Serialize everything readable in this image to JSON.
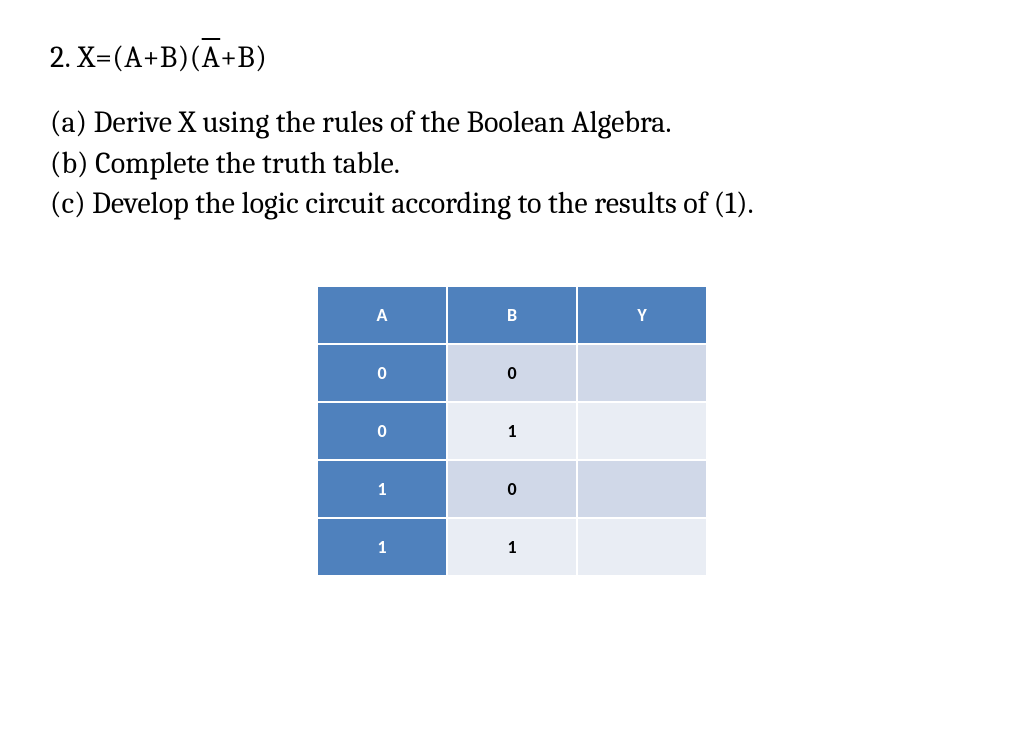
{
  "problem": {
    "number": "2.",
    "eq_lhs": "X=",
    "eq_paren1_open": "(",
    "eq_A1": "A",
    "eq_plus1": "+",
    "eq_B1": "B",
    "eq_paren1_close": ")",
    "eq_paren2_open": "(",
    "eq_Abar": "A",
    "eq_plus2": "+",
    "eq_B2": "B",
    "eq_paren2_close": ")"
  },
  "parts": {
    "a": "(a) Derive X using the rules of the Boolean Algebra.",
    "b": "(b) Complete the truth table.",
    "c": "(c) Develop the logic circuit according to the results of (1)."
  },
  "table": {
    "headers": {
      "A": "A",
      "B": "B",
      "Y": "Y"
    },
    "rows": [
      {
        "A": "0",
        "B": "0",
        "Y": ""
      },
      {
        "A": "0",
        "B": "1",
        "Y": ""
      },
      {
        "A": "1",
        "B": "0",
        "Y": ""
      },
      {
        "A": "1",
        "B": "1",
        "Y": ""
      }
    ]
  }
}
